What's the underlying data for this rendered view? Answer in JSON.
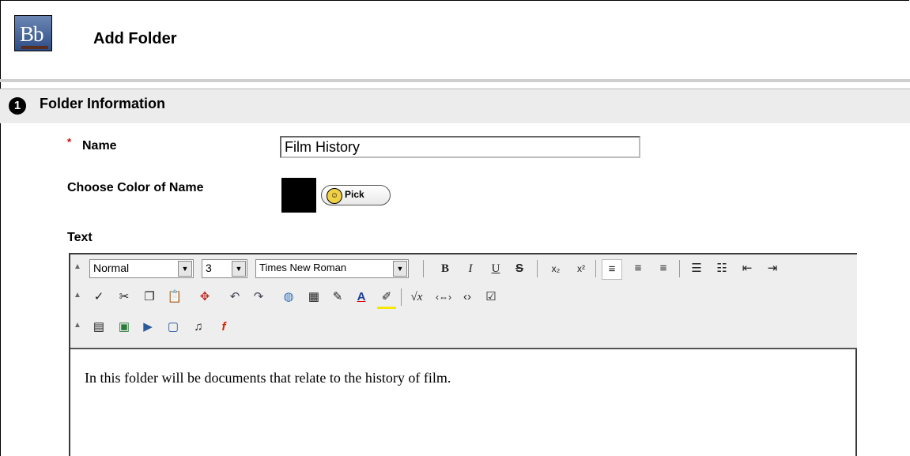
{
  "header": {
    "logo_text": "Bb",
    "title": "Add Folder"
  },
  "section": {
    "step": "1",
    "title": "Folder Information"
  },
  "form": {
    "required_marker": "*",
    "name_label": "Name",
    "name_value": "Film History",
    "color_label": "Choose Color of Name",
    "color_value": "#000000",
    "pick_label": "Pick",
    "text_label": "Text"
  },
  "editor": {
    "style_select": "Normal",
    "size_select": "3",
    "font_select": "Times New Roman",
    "content": "In this folder will be documents that relate to the history of film."
  },
  "icons": {
    "row1": [
      "bold-icon",
      "italic-icon",
      "underline-icon",
      "strikethrough-icon",
      "subscript-icon",
      "superscript-icon",
      "align-left-icon",
      "align-center-icon",
      "align-right-icon",
      "ordered-list-icon",
      "unordered-list-icon",
      "outdent-icon",
      "indent-icon"
    ],
    "row2": [
      "spellcheck-icon",
      "cut-icon",
      "copy-icon",
      "paste-icon",
      "link-icon",
      "undo-icon",
      "redo-icon",
      "hyperlink-icon",
      "table-icon",
      "pencil-icon",
      "font-color-icon",
      "highlight-icon",
      "equation-icon",
      "html-icon",
      "source-icon",
      "preview-icon"
    ],
    "row3": [
      "attach-file-icon",
      "image-icon",
      "media-icon",
      "document-icon",
      "audio-icon",
      "flash-icon"
    ]
  }
}
